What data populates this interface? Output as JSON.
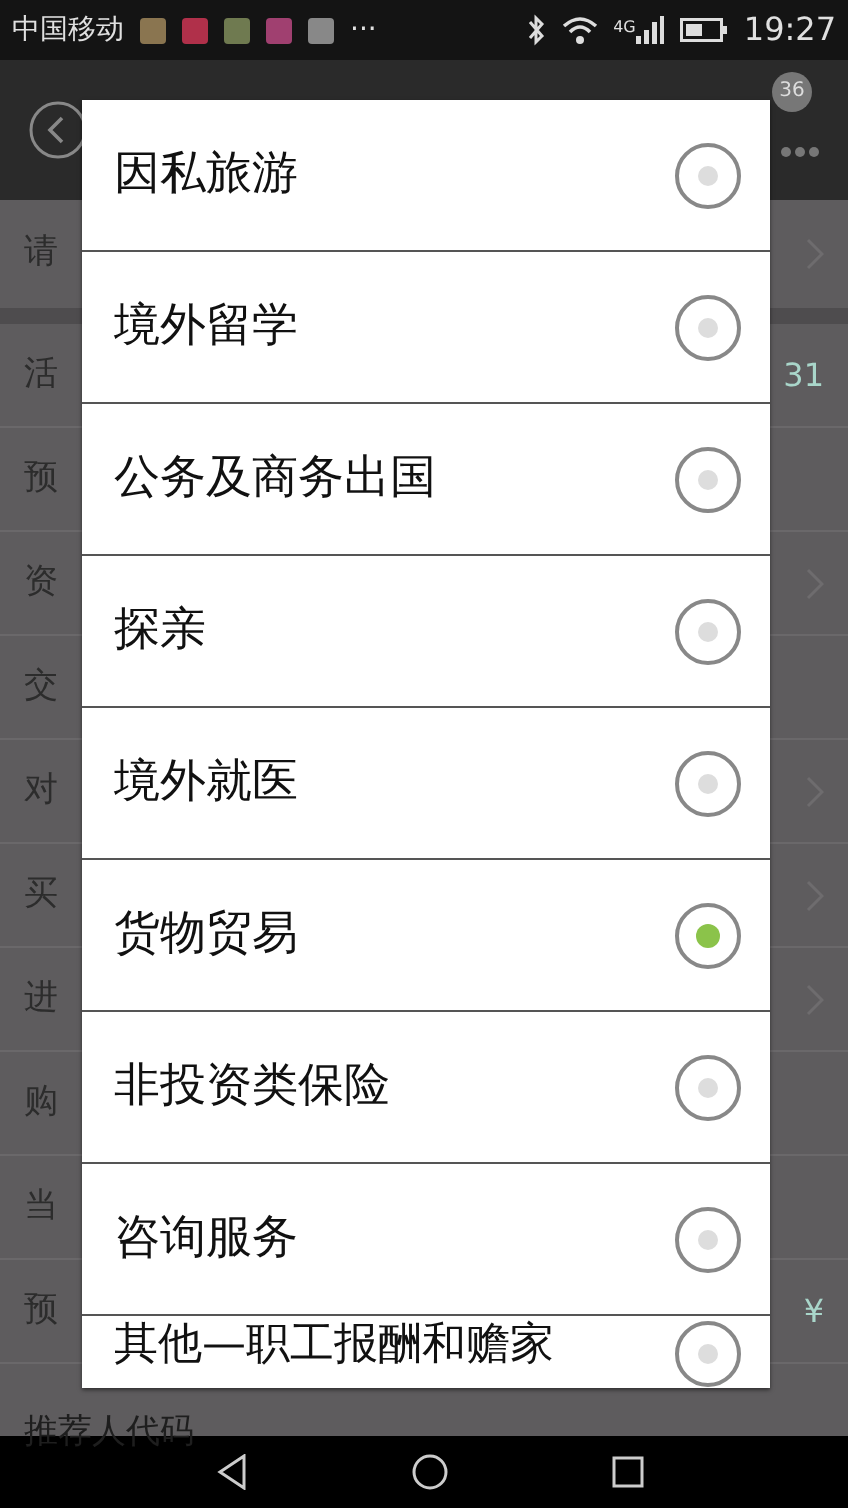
{
  "status_bar": {
    "carrier": "中国移动",
    "more": "···",
    "network": "4G",
    "time": "19:27"
  },
  "header": {
    "badge": "36"
  },
  "form": {
    "rows": [
      {
        "label": "请",
        "kind": "select"
      },
      {
        "label": "活",
        "kind": "text",
        "value": "31"
      },
      {
        "label": "预",
        "kind": "text"
      },
      {
        "label": "资",
        "kind": "select"
      },
      {
        "label": "交",
        "kind": "text"
      },
      {
        "label": "对",
        "kind": "select"
      },
      {
        "label": "买",
        "kind": "select"
      },
      {
        "label": "进",
        "kind": "select"
      },
      {
        "label": "购",
        "kind": "text"
      },
      {
        "label": "当",
        "kind": "text"
      },
      {
        "label": "预",
        "kind": "text",
        "value": "¥"
      },
      {
        "label": "推荐人代码",
        "kind": "text"
      }
    ]
  },
  "dialog": {
    "options": [
      {
        "label": "因私旅游",
        "selected": false
      },
      {
        "label": "境外留学",
        "selected": false
      },
      {
        "label": "公务及商务出国",
        "selected": false
      },
      {
        "label": "探亲",
        "selected": false
      },
      {
        "label": "境外就医",
        "selected": false
      },
      {
        "label": "货物贸易",
        "selected": true
      },
      {
        "label": "非投资类保险",
        "selected": false
      },
      {
        "label": "咨询服务",
        "selected": false
      },
      {
        "label": "其他—职工报酬和赡家",
        "selected": false
      }
    ]
  }
}
